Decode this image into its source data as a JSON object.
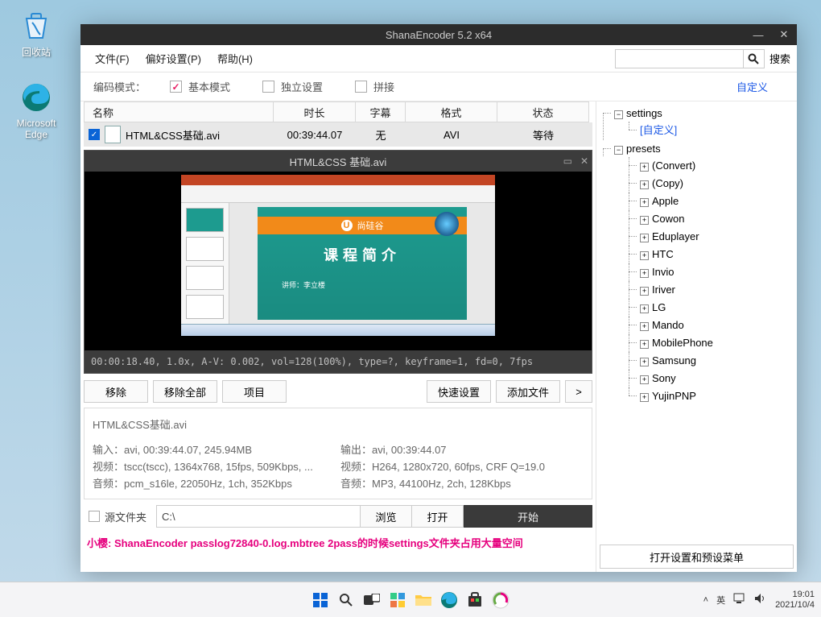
{
  "desktop": {
    "recycle": "回收站",
    "edge": "Microsoft\nEdge"
  },
  "taskbar": {
    "ime": "英",
    "time": "19:01",
    "date": "2021/10/4"
  },
  "app": {
    "title": "ShanaEncoder 5.2 x64",
    "menu": {
      "file": "文件(F)",
      "pref": "偏好设置(P)",
      "help": "帮助(H)",
      "searchLabel": "搜索"
    },
    "search": {
      "placeholder": ""
    },
    "mode": {
      "label": "编码模式：",
      "basic": "基本模式",
      "indep": "独立设置",
      "concat": "拼接",
      "customize": "自定义"
    },
    "cols": {
      "name": "名称",
      "dur": "时长",
      "sub": "字幕",
      "fmt": "格式",
      "state": "状态"
    },
    "row": {
      "name": "HTML&CSS基础.avi",
      "dur": "00:39:44.07",
      "sub": "无",
      "fmt": "AVI",
      "state": "等待"
    },
    "preview": {
      "title": "HTML&CSS 基础.avi",
      "slideTitle": "课程简介",
      "brand": "尚硅谷",
      "lecturer": "讲师：李立楼",
      "status": "00:00:18.40, 1.0x, A-V:  0.002, vol=128(100%), type=?, keyframe=1, fd=0, 7fps"
    },
    "buttons": {
      "remove": "移除",
      "removeAll": "移除全部",
      "item": "项目",
      "quick": "快速设置",
      "add": "添加文件",
      "more": ">"
    },
    "info": {
      "fname": "HTML&CSS基础.avi",
      "inLabel": "输入：",
      "in": "avi, 00:39:44.07, 245.94MB",
      "inV": "视频：",
      "inVv": "tscc(tscc), 1364x768, 15fps, 509Kbps, ...",
      "inA": "音频：",
      "inAv": "pcm_s16le, 22050Hz, 1ch, 352Kbps",
      "outLabel": "输出：",
      "out": "avi, 00:39:44.07",
      "outV": "视频：",
      "outVv": "H264, 1280x720, 60fps, CRF Q=19.0",
      "outA": "音频：",
      "outAv": "MP3, 44100Hz, 2ch, 128Kbps"
    },
    "path": {
      "srcLabel": "源文件夹",
      "value": "C:\\",
      "browse": "浏览",
      "open": "打开",
      "start": "开始"
    },
    "msg": "小樱: ShanaEncoder passlog72840-0.log.mbtree 2pass的时候settings文件夹占用大量空间",
    "tree": {
      "settings": "settings",
      "custom": "[自定义]",
      "presets": "presets",
      "items": [
        "(Convert)",
        "(Copy)",
        "Apple",
        "Cowon",
        "Eduplayer",
        "HTC",
        "Invio",
        "Iriver",
        "LG",
        "Mando",
        "MobilePhone",
        "Samsung",
        "Sony",
        "YujinPNP"
      ],
      "openPreset": "打开设置和预设菜单"
    }
  }
}
